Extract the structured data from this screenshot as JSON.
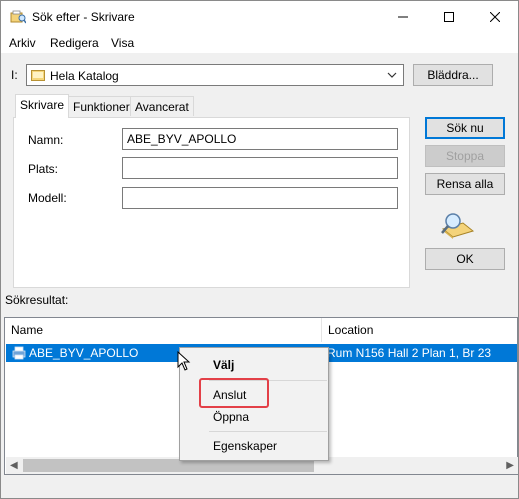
{
  "window": {
    "title": "Sök efter - Skrivare",
    "icon": "search-printer-icon",
    "controls": [
      "minimize-icon",
      "maximize-icon",
      "close-icon"
    ]
  },
  "menu": {
    "items": [
      "Arkiv",
      "Redigera",
      "Visa"
    ]
  },
  "location": {
    "label": "I:",
    "value": "Hela Katalog",
    "browse_label": "Bläddra..."
  },
  "tabs": [
    {
      "label": "Skrivare",
      "active": true
    },
    {
      "label": "Funktioner",
      "active": false
    },
    {
      "label": "Avancerat",
      "active": false
    }
  ],
  "form": {
    "name_label": "Namn:",
    "name_value": "ABE_BYV_APOLLO",
    "location_label": "Plats:",
    "location_value": "",
    "model_label": "Modell:",
    "model_value": ""
  },
  "actions": {
    "search_now": "Sök nu",
    "stop": "Stoppa",
    "clear_all": "Rensa alla",
    "ok": "OK"
  },
  "results": {
    "label": "Sökresultat:",
    "columns": [
      "Name",
      "Location"
    ],
    "rows": [
      {
        "name": "ABE_BYV_APOLLO",
        "location": "Rum N156 Hall 2 Plan 1, Br 23",
        "selected": true
      }
    ]
  },
  "context_menu": {
    "items": [
      "Välj",
      "Anslut",
      "Öppna",
      "Egenskaper"
    ],
    "highlighted": "Anslut"
  },
  "colors": {
    "selection": "#0078d7",
    "highlight_box": "#e34048",
    "default_button_border": "#0078d7"
  }
}
